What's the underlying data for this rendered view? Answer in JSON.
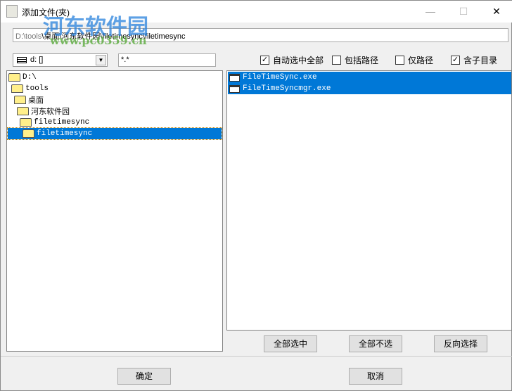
{
  "window": {
    "title": "添加文件(夹)",
    "minimize": "—",
    "maximize": "☐",
    "close": "✕"
  },
  "path": {
    "dim_prefix": "D:\\tools",
    "value": "\\桌面\\河东软件园\\filetimesync\\filetimesync"
  },
  "drive": {
    "selected": "d: []"
  },
  "filter": {
    "value": "*.*"
  },
  "options": [
    {
      "label": "自动选中全部",
      "checked": true
    },
    {
      "label": "包括路径",
      "checked": false
    },
    {
      "label": "仅路径",
      "checked": false
    },
    {
      "label": "含子目录",
      "checked": true
    }
  ],
  "tree": [
    {
      "label": "D:\\",
      "level": 0,
      "selected": false
    },
    {
      "label": "tools",
      "level": 1,
      "selected": false
    },
    {
      "label": "桌面",
      "level": 2,
      "selected": false
    },
    {
      "label": "河东软件园",
      "level": 3,
      "selected": false
    },
    {
      "label": "filetimesync",
      "level": 4,
      "selected": false
    },
    {
      "label": "filetimesync",
      "level": 5,
      "selected": true
    }
  ],
  "files": [
    {
      "name": "FileTimeSync.exe"
    },
    {
      "name": "FileTimeSyncmgr.exe"
    }
  ],
  "buttons": {
    "select_all": "全部选中",
    "select_none": "全部不选",
    "invert": "反向选择",
    "ok": "确定",
    "cancel": "取消"
  },
  "watermark": {
    "site": "河东软件园",
    "url": "www.pc0359.cn"
  }
}
